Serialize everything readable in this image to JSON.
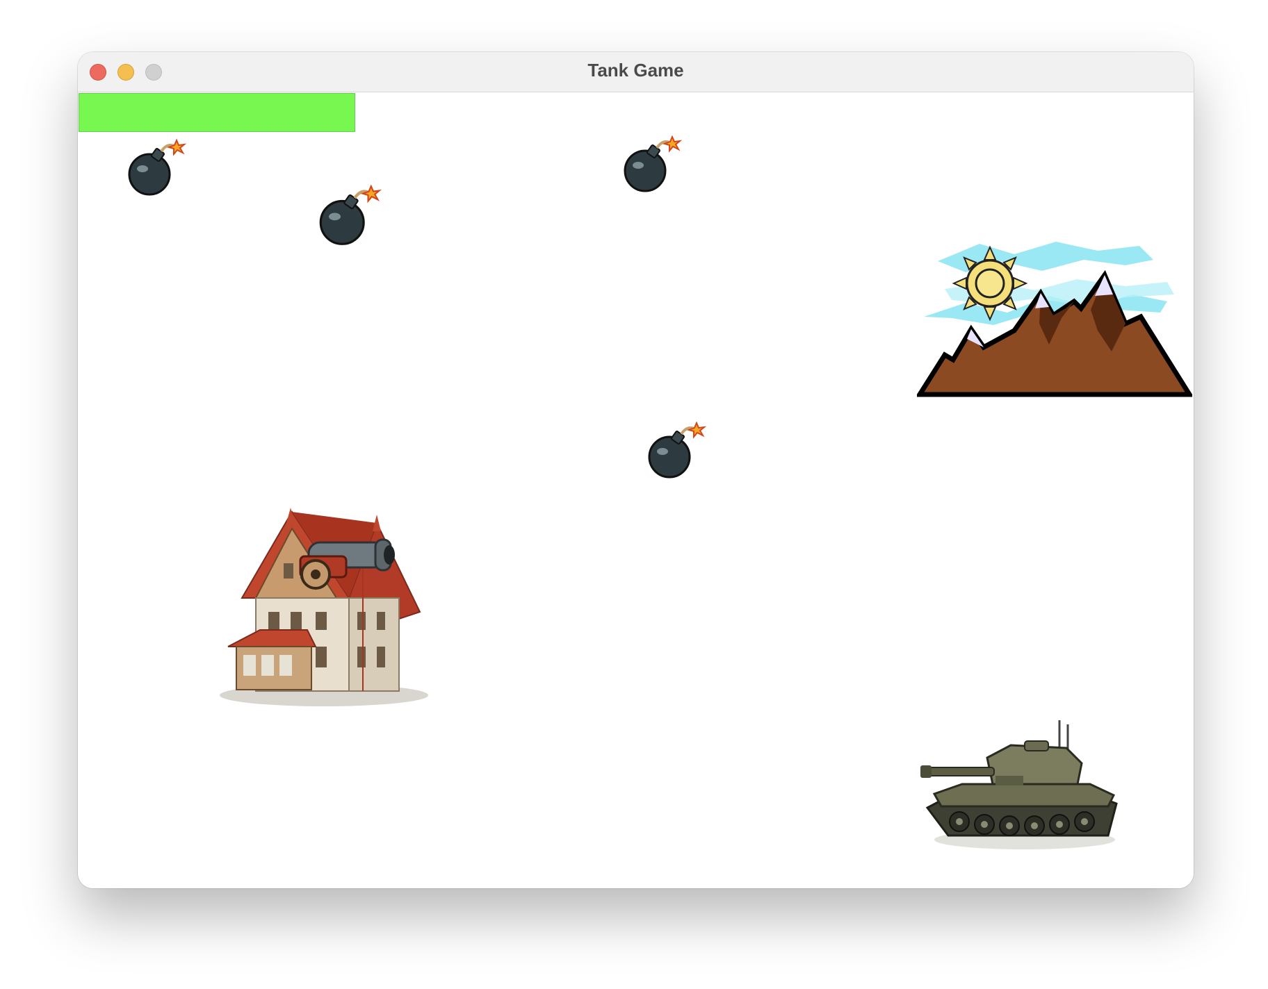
{
  "window": {
    "title": "Tank Game"
  },
  "hud": {
    "health_fraction": 1.0,
    "health_color": "#77f74f"
  },
  "sprites": {
    "bomb_count": 4,
    "icons": [
      "bomb-icon",
      "mountain-sun-icon",
      "house-cannon-icon",
      "tank-icon"
    ]
  },
  "colors": {
    "bomb_body": "#2d3b40",
    "fuse_spark": "#f6a623",
    "mountain": "#8b4a22",
    "sky": "#9be8f5",
    "sun": "#f5df7a",
    "roof": "#c0462e",
    "tank": "#6e6f52"
  }
}
